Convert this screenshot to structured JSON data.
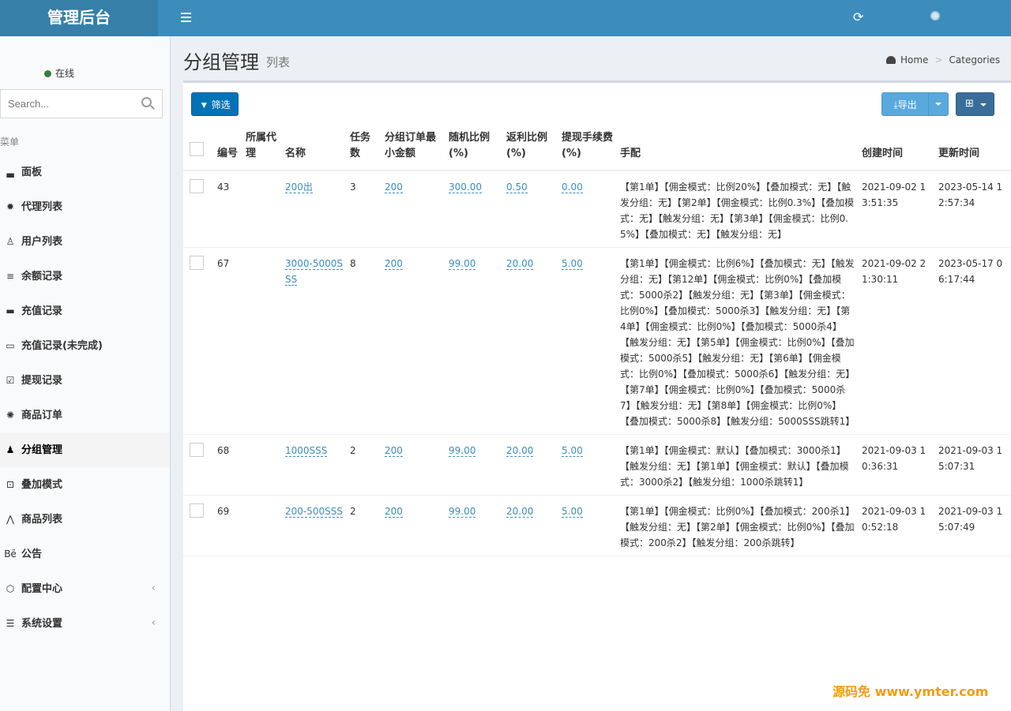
{
  "header": {
    "logo": "管理后台"
  },
  "sidebar": {
    "status": "在线",
    "search_placeholder": "Search...",
    "menu_header": "菜单",
    "items": [
      {
        "label": "面板",
        "icon": "area-chart-icon",
        "glyph": "▃"
      },
      {
        "label": "代理列表",
        "icon": "gear-icon",
        "glyph": "✹"
      },
      {
        "label": "用户列表",
        "icon": "users-icon",
        "glyph": "♙"
      },
      {
        "label": "余额记录",
        "icon": "list-icon",
        "glyph": "≡"
      },
      {
        "label": "充值记录",
        "icon": "card-icon",
        "glyph": "▬"
      },
      {
        "label": "充值记录(未完成)",
        "icon": "card-outline-icon",
        "glyph": "▭"
      },
      {
        "label": "提现记录",
        "icon": "check-square-icon",
        "glyph": "☑"
      },
      {
        "label": "商品订单",
        "icon": "cog-icon",
        "glyph": "✺"
      },
      {
        "label": "分组管理",
        "icon": "group-icon",
        "glyph": "♟"
      },
      {
        "label": "叠加模式",
        "icon": "tv-icon",
        "glyph": "⊡"
      },
      {
        "label": "商品列表",
        "icon": "leaf-icon",
        "glyph": "⋀"
      },
      {
        "label": "公告",
        "icon": "behance-icon",
        "glyph": "Bē"
      },
      {
        "label": "配置中心",
        "icon": "hexagon-icon",
        "glyph": "⬡"
      },
      {
        "label": "系统设置",
        "icon": "server-icon",
        "glyph": "☰"
      }
    ]
  },
  "page": {
    "title": "分组管理",
    "subtitle": "列表"
  },
  "breadcrumb": {
    "home": "Home",
    "sep": ">",
    "current": "Categories"
  },
  "toolbar": {
    "filter_label": "筛选",
    "export_label": "导出"
  },
  "table": {
    "headers": [
      "编号",
      "所属代理",
      "名称",
      "任务数",
      "分组订单最小金额",
      "随机比例(%)",
      "返利比例(%)",
      "提现手续费(%)",
      "手配",
      "创建时间",
      "更新时间"
    ],
    "rows": [
      {
        "id": "43",
        "agent": "",
        "name": "200出",
        "tasks": "3",
        "min": "200",
        "random": "300.00",
        "rebate": "0.50",
        "fee": "0.00",
        "config": "【第1单】【佣金模式：比例20%】【叠加模式：无】【触发分组：无】【第2单】【佣金模式：比例0.3%】【叠加模式：无】【触发分组：无】【第3单】【佣金模式：比例0.5%】【叠加模式：无】【触发分组：无】",
        "created": "2021-09-02 13:51:35",
        "updated": "2023-05-14 12:57:34"
      },
      {
        "id": "67",
        "agent": "",
        "name": "3000-5000SSS",
        "tasks": "8",
        "min": "200",
        "random": "99.00",
        "rebate": "20.00",
        "fee": "5.00",
        "config": "【第1单】【佣金模式：比例6%】【叠加模式：无】【触发分组：无】【第12单】【佣金模式：比例0%】【叠加模式：5000杀2】【触发分组：无】【第3单】【佣金模式：比例0%】【叠加模式：5000杀3】【触发分组：无】【第4单】【佣金模式：比例0%】【叠加模式：5000杀4】【触发分组：无】【第5单】【佣金模式：比例0%】【叠加模式：5000杀5】【触发分组：无】【第6单】【佣金模式：比例0%】【叠加模式：5000杀6】【触发分组：无】【第7单】【佣金模式：比例0%】【叠加模式：5000杀7】【触发分组：无】【第8单】【佣金模式：比例0%】【叠加模式：5000杀8】【触发分组：5000SSS跳转1】",
        "created": "2021-09-02 21:30:11",
        "updated": "2023-05-17 06:17:44"
      },
      {
        "id": "68",
        "agent": "",
        "name": "1000SSS",
        "tasks": "2",
        "min": "200",
        "random": "99.00",
        "rebate": "20.00",
        "fee": "5.00",
        "config": "【第1单】【佣金模式：默认】【叠加模式：3000杀1】【触发分组：无】【第1单】【佣金模式：默认】【叠加模式：3000杀2】【触发分组：1000杀跳转1】",
        "created": "2021-09-03 10:36:31",
        "updated": "2021-09-03 15:07:31"
      },
      {
        "id": "69",
        "agent": "",
        "name": "200-500SSS",
        "tasks": "2",
        "min": "200",
        "random": "99.00",
        "rebate": "20.00",
        "fee": "5.00",
        "config": "【第1单】【佣金模式：比例0%】【叠加模式：200杀1】【触发分组：无】【第2单】【佣金模式：比例0%】【叠加模式：200杀2】【触发分组：200杀跳转】",
        "created": "2021-09-03 10:52:18",
        "updated": "2021-09-03 15:07:49"
      }
    ]
  },
  "watermark": "源码免 www.ymter.com"
}
